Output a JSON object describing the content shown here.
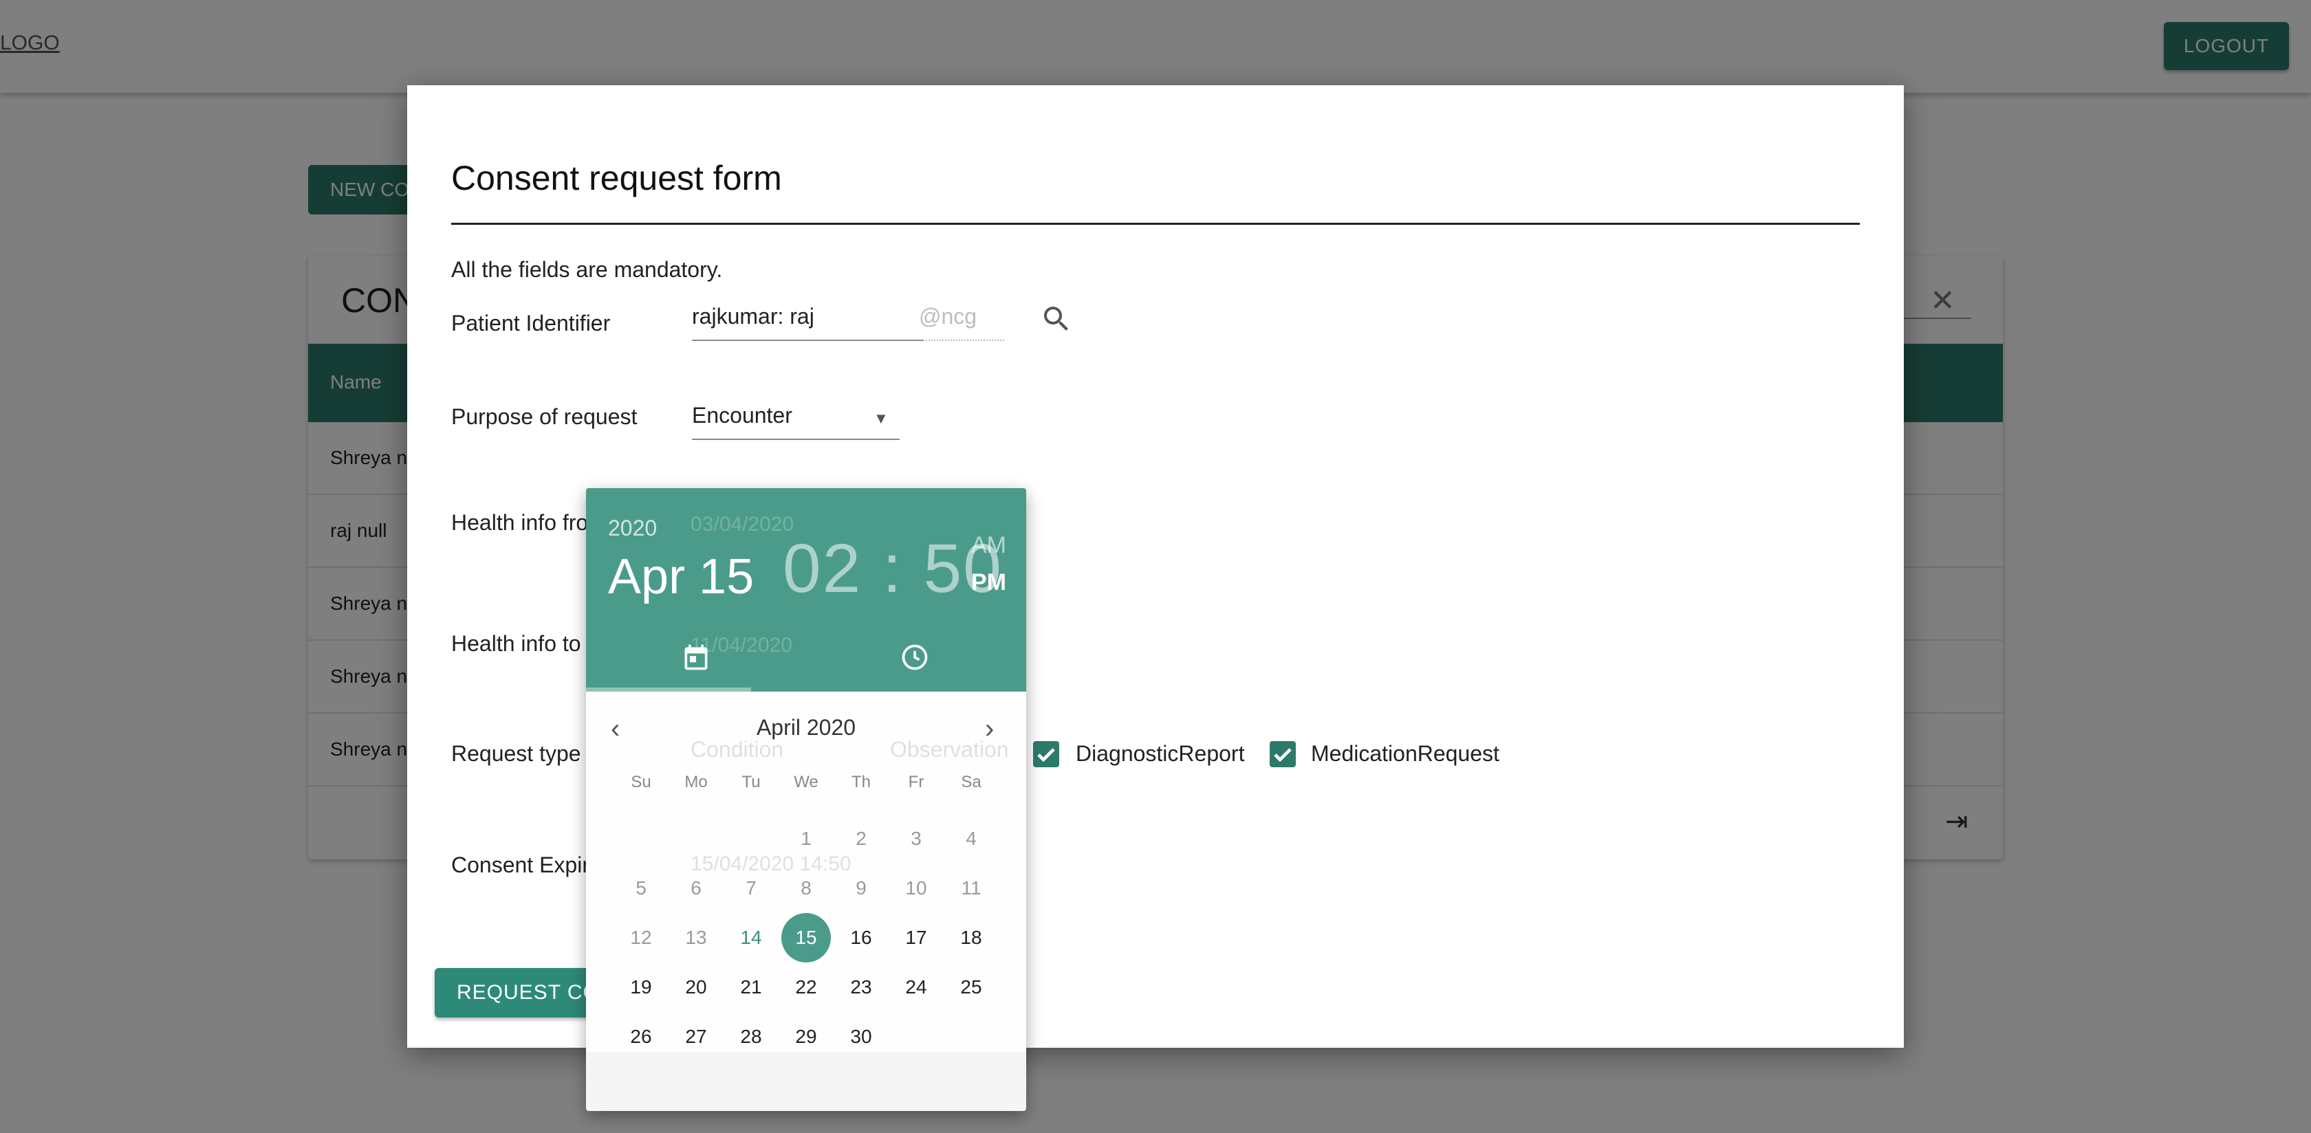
{
  "app": {
    "logo_text": "LOGO",
    "logout_label": "LOGOUT",
    "new_consent_label": "NEW CONSENT REQUEST",
    "card_title": "CONSENTS",
    "table": {
      "columns": [
        "Name"
      ],
      "rows": [
        "Shreya null",
        "raj null",
        "Shreya null",
        "Shreya null",
        "Shreya null"
      ]
    }
  },
  "dialog": {
    "title": "Consent request form",
    "note": "All the fields are mandatory.",
    "patient_identifier": {
      "label": "Patient Identifier",
      "value": "rajkumar: raj",
      "suffix": "@ncg"
    },
    "purpose": {
      "label": "Purpose of request",
      "value": "Encounter"
    },
    "health_from": {
      "label": "Health info from",
      "value": "03/04/2020"
    },
    "health_to": {
      "label": "Health info to",
      "value": "11/04/2020"
    },
    "request_type": {
      "label": "Request type",
      "options": [
        {
          "label": "Condition",
          "checked": true
        },
        {
          "label": "Observation",
          "checked": true
        },
        {
          "label": "DiagnosticReport",
          "checked": true
        },
        {
          "label": "MedicationRequest",
          "checked": true
        }
      ]
    },
    "consent_expiry": {
      "label": "Consent Expiry",
      "value": "15/04/2020 14:50"
    },
    "submit_label": "REQUEST CONSENT"
  },
  "picker": {
    "year": "2020",
    "date": "Apr 15",
    "hour": "02",
    "minute": "50",
    "am": "AM",
    "pm": "PM",
    "month_title": "April 2020",
    "weekdays": [
      "Su",
      "Mo",
      "Tu",
      "We",
      "Th",
      "Fr",
      "Sa"
    ],
    "days": [
      "1",
      "2",
      "3",
      "4",
      "5",
      "6",
      "7",
      "8",
      "9",
      "10",
      "11",
      "12",
      "13",
      "14",
      "15",
      "16",
      "17",
      "18",
      "19",
      "20",
      "21",
      "22",
      "23",
      "24",
      "25",
      "26",
      "27",
      "28",
      "29",
      "30"
    ],
    "selected_day": "15",
    "today_day": "14",
    "accent": "#4b9b8b"
  },
  "colors": {
    "primary": "#2d7a6a",
    "overlay": "rgba(0,0,0,0.5)"
  }
}
